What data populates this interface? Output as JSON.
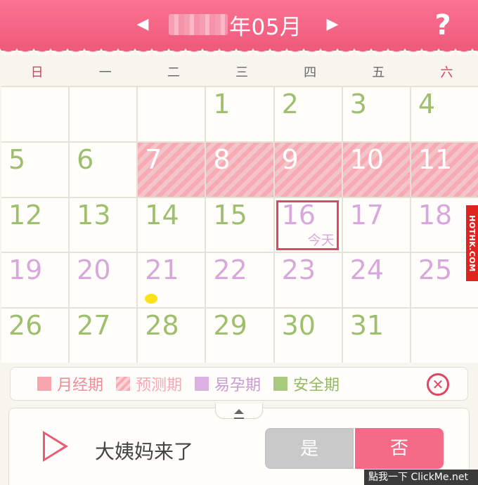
{
  "header": {
    "prev_icon": "◀",
    "next_icon": "▶",
    "title": "年05月",
    "help_label": "?"
  },
  "weekdays": [
    "日",
    "一",
    "二",
    "三",
    "四",
    "五",
    "六"
  ],
  "calendar": {
    "today_label": "今天",
    "days": [
      {
        "n": "",
        "t": "empty"
      },
      {
        "n": "",
        "t": "empty"
      },
      {
        "n": "",
        "t": "empty"
      },
      {
        "n": "1",
        "t": "safe"
      },
      {
        "n": "2",
        "t": "safe"
      },
      {
        "n": "3",
        "t": "safe"
      },
      {
        "n": "4",
        "t": "safe"
      },
      {
        "n": "5",
        "t": "safe"
      },
      {
        "n": "6",
        "t": "safe"
      },
      {
        "n": "7",
        "t": "predict"
      },
      {
        "n": "8",
        "t": "predict"
      },
      {
        "n": "9",
        "t": "predict"
      },
      {
        "n": "10",
        "t": "predict"
      },
      {
        "n": "11",
        "t": "predict"
      },
      {
        "n": "12",
        "t": "safe"
      },
      {
        "n": "13",
        "t": "safe"
      },
      {
        "n": "14",
        "t": "safe"
      },
      {
        "n": "15",
        "t": "safe"
      },
      {
        "n": "16",
        "t": "today"
      },
      {
        "n": "17",
        "t": "fertile"
      },
      {
        "n": "18",
        "t": "fertile"
      },
      {
        "n": "19",
        "t": "fertile"
      },
      {
        "n": "20",
        "t": "fertile"
      },
      {
        "n": "21",
        "t": "fertile-dot"
      },
      {
        "n": "22",
        "t": "fertile"
      },
      {
        "n": "23",
        "t": "fertile"
      },
      {
        "n": "24",
        "t": "fertile"
      },
      {
        "n": "25",
        "t": "fertile"
      },
      {
        "n": "26",
        "t": "safe"
      },
      {
        "n": "27",
        "t": "safe"
      },
      {
        "n": "28",
        "t": "safe"
      },
      {
        "n": "29",
        "t": "safe"
      },
      {
        "n": "30",
        "t": "safe"
      },
      {
        "n": "31",
        "t": "safe"
      },
      {
        "n": "",
        "t": "empty"
      }
    ]
  },
  "side_tag": "HOTHK.COM",
  "legend": {
    "period": "月经期",
    "predict": "预测期",
    "fertile": "易孕期",
    "safe": "安全期",
    "close_icon": "✕"
  },
  "panel": {
    "question": "大姨妈来了",
    "yes_label": "是",
    "no_label": "否"
  },
  "watermark": "點我一下 ClickMe.net",
  "colors": {
    "header": "#ef5a7b",
    "safe": "#9dbf6e",
    "fertile": "#d8a8dc",
    "predict": "#f7aab3",
    "today_border": "#e04563"
  }
}
